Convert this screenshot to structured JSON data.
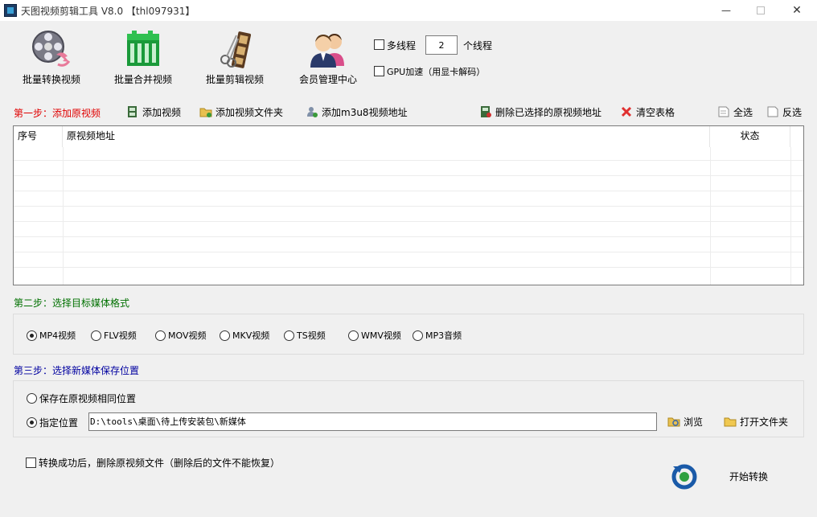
{
  "window": {
    "title": "天图视频剪辑工具 V8.0 【thl097931】",
    "minimize": "—",
    "close": "✕"
  },
  "toolbar": {
    "convert": "批量转换视频",
    "merge": "批量合并视频",
    "edit": "批量剪辑视频",
    "member": "会员管理中心"
  },
  "options": {
    "multithread_label": "多线程",
    "thread_count": "2",
    "thread_unit": "个线程",
    "gpu_label": "GPU加速（用显卡解码）"
  },
  "step1": {
    "title": "第一步：添加原视频",
    "add_video": "添加视频",
    "add_folder": "添加视频文件夹",
    "add_m3u8": "添加m3u8视频地址",
    "delete_selected": "删除已选择的原视频地址",
    "clear_table": "清空表格",
    "select_all": "全选",
    "invert": "反选",
    "columns": [
      "序号",
      "原视频地址",
      "状态"
    ]
  },
  "step2": {
    "title": "第二步：选择目标媒体格式",
    "formats": [
      "MP4视频",
      "FLV视频",
      "MOV视频",
      "MKV视频",
      "TS视频",
      "WMV视频",
      "MP3音频"
    ],
    "selected": "MP4视频"
  },
  "step3": {
    "title": "第三步：选择新媒体保存位置",
    "same_location": "保存在原视频相同位置",
    "custom_location": "指定位置",
    "path": "D:\\tools\\桌面\\待上传安装包\\新媒体",
    "browse": "浏览",
    "open_folder": "打开文件夹"
  },
  "footer": {
    "delete_source": "转换成功后，删除原视频文件（删除后的文件不能恢复）",
    "start": "开始转换"
  },
  "colors": {
    "step1": "#e00000",
    "step2": "#007000",
    "step3": "#0000a0"
  }
}
